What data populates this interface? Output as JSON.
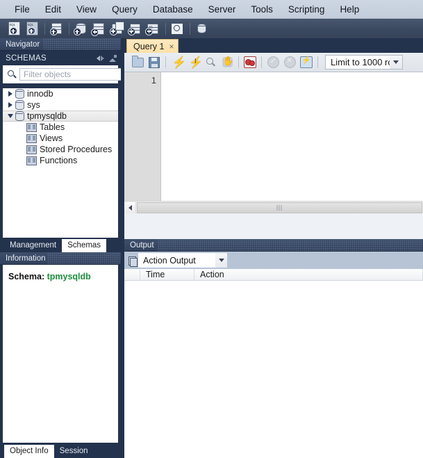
{
  "menubar": {
    "items": [
      {
        "label": "File"
      },
      {
        "label": "Edit"
      },
      {
        "label": "View"
      },
      {
        "label": "Query"
      },
      {
        "label": "Database"
      },
      {
        "label": "Server"
      },
      {
        "label": "Tools"
      },
      {
        "label": "Scripting"
      },
      {
        "label": "Help"
      }
    ]
  },
  "toolbar": {
    "buttons": [
      {
        "name": "new-sql-tab-icon",
        "title": "New SQL Tab"
      },
      {
        "name": "open-sql-script-icon",
        "title": "Open SQL Script"
      },
      {
        "name": "connection-info-icon",
        "title": "Connection Information"
      },
      {
        "name": "new-schema-icon",
        "title": "Create New Schema"
      },
      {
        "name": "new-table-icon",
        "title": "Create New Table"
      },
      {
        "name": "new-view-icon",
        "title": "Create New View"
      },
      {
        "name": "new-procedure-icon",
        "title": "Create New Stored Procedure"
      },
      {
        "name": "new-function-icon",
        "title": "Create New Function"
      },
      {
        "name": "search-data-icon",
        "title": "Search Table Data"
      },
      {
        "name": "reconnect-icon",
        "title": "Reconnect to DBMS"
      }
    ]
  },
  "sidebar": {
    "navigator_title": "Navigator",
    "schemas_title": "SCHEMAS",
    "filter_placeholder": "Filter objects",
    "tree": [
      {
        "label": "innodb",
        "type": "schema",
        "expanded": false,
        "selected": false
      },
      {
        "label": "sys",
        "type": "schema",
        "expanded": false,
        "selected": false
      },
      {
        "label": "tpmysqldb",
        "type": "schema",
        "expanded": true,
        "selected": true
      },
      {
        "label": "Tables",
        "type": "object",
        "child": true
      },
      {
        "label": "Views",
        "type": "object",
        "child": true
      },
      {
        "label": "Stored Procedures",
        "type": "object",
        "child": true
      },
      {
        "label": "Functions",
        "type": "object",
        "child": true
      }
    ],
    "tabs": [
      {
        "label": "Management",
        "active": false
      },
      {
        "label": "Schemas",
        "active": true
      }
    ],
    "information": {
      "title": "Information",
      "schema_label": "Schema:",
      "schema_value": "tpmysqldb",
      "schema_value_color": "#1e8e3e"
    },
    "bottom_tabs": [
      {
        "label": "Object Info",
        "active": true
      },
      {
        "label": "Session",
        "active": false
      }
    ]
  },
  "main": {
    "query_tab": {
      "label": "Query 1",
      "close": "×"
    },
    "query_toolbar": {
      "buttons": [
        {
          "name": "open-script-icon",
          "title": "Open a script file in this editor"
        },
        {
          "name": "save-script-icon",
          "title": "Save script to file"
        },
        {
          "name": "execute-statement-icon",
          "title": "Execute the selected portion of the script"
        },
        {
          "name": "execute-current-statement-icon",
          "title": "Execute the statement under the keyboard cursor"
        },
        {
          "name": "explain-query-icon",
          "title": "Explain the statement under the cursor"
        },
        {
          "name": "stop-execution-icon",
          "title": "Stop the query being executed"
        },
        {
          "name": "toggle-stop-on-error-icon",
          "title": "Toggle whether execution should stop on errors"
        },
        {
          "name": "commit-icon",
          "title": "Commit"
        },
        {
          "name": "rollback-icon",
          "title": "Rollback"
        },
        {
          "name": "autocommit-icon",
          "title": "Toggle Auto-Commit Mode"
        }
      ],
      "limit_value": "Limit to 1000 ro"
    },
    "editor": {
      "line_numbers": [
        "1"
      ],
      "content": ""
    }
  },
  "output": {
    "title": "Output",
    "selector_value": "Action Output",
    "columns": [
      "",
      "Time",
      "Action"
    ],
    "rows": []
  },
  "colors": {
    "chrome_dark": "#24334d",
    "panel_header": "#32415c",
    "menu_bg": "#c8d1de",
    "tab_active": "#fbe0a8",
    "schema_green": "#1e8e3e"
  }
}
